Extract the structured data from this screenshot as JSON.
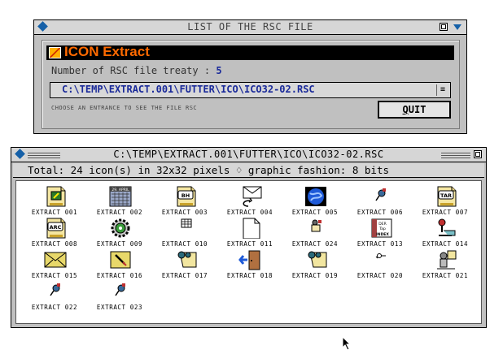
{
  "dialog": {
    "title": "LIST OF THE RSC FILE",
    "banner": "ICON Extract",
    "count_label": "Number of RSC file treaty :",
    "count_value": "5",
    "path": "C:\\TEMP\\EXTRACT.001\\FUTTER\\ICO\\ICO32-02.RSC",
    "hint": "CHOOSE AN ENTRANCE TO SEE THE FILE RSC",
    "quit_first": "Q",
    "quit_rest": "UIT"
  },
  "viewer": {
    "title": "C:\\TEMP\\EXTRACT.001\\FUTTER\\ICO\\ICO32-02.RSC",
    "info": "Total: 24 icon(s) in 32x32 pixels ♢ graphic fashion: 8 bits",
    "icons": [
      {
        "label": "EXTRACT 001",
        "icon": "document-stamp-icon"
      },
      {
        "label": "EXTRACT 002",
        "icon": "calendar-icon",
        "text": "29. APRIL"
      },
      {
        "label": "EXTRACT 003",
        "icon": "bh-document-icon",
        "text": "BH"
      },
      {
        "label": "EXTRACT 004",
        "icon": "mail-return-icon"
      },
      {
        "label": "EXTRACT 005",
        "icon": "blue-globe-icon"
      },
      {
        "label": "EXTRACT 006",
        "icon": "small-pin-icon"
      },
      {
        "label": "EXTRACT 007",
        "icon": "tar-document-icon",
        "text": "TAR"
      },
      {
        "label": "EXTRACT 008",
        "icon": "arc-document-icon",
        "text": "ARC"
      },
      {
        "label": "EXTRACT 009",
        "icon": "gear-icon"
      },
      {
        "label": "EXTRACT 010",
        "icon": "small-grid-icon"
      },
      {
        "label": "EXTRACT 011",
        "icon": "blank-page-icon"
      },
      {
        "label": "EXTRACT 024",
        "icon": "small-figure-icon"
      },
      {
        "label": "EXTRACT 013",
        "icon": "index-card-icon",
        "text": "INDEX"
      },
      {
        "label": "EXTRACT 014",
        "icon": "hand-key-icon"
      },
      {
        "label": "EXTRACT 015",
        "icon": "envelope-icon"
      },
      {
        "label": "EXTRACT 016",
        "icon": "pen-note-icon"
      },
      {
        "label": "EXTRACT 017",
        "icon": "pin-note-icon"
      },
      {
        "label": "EXTRACT 018",
        "icon": "exit-door-icon"
      },
      {
        "label": "EXTRACT 019",
        "icon": "pin-note-icon"
      },
      {
        "label": "EXTRACT 020",
        "icon": "small-key-icon"
      },
      {
        "label": "EXTRACT 021",
        "icon": "figure-note-icon"
      },
      {
        "label": "EXTRACT 022",
        "icon": "small-pin-icon"
      },
      {
        "label": "EXTRACT 023",
        "icon": "small-pin-icon"
      }
    ]
  },
  "colors": {
    "desktop": "#ffffff",
    "window": "#c0c0c0",
    "titlebar": "#d6d6d6",
    "accent": "#1560a8",
    "banner_text": "#ff6a00"
  }
}
